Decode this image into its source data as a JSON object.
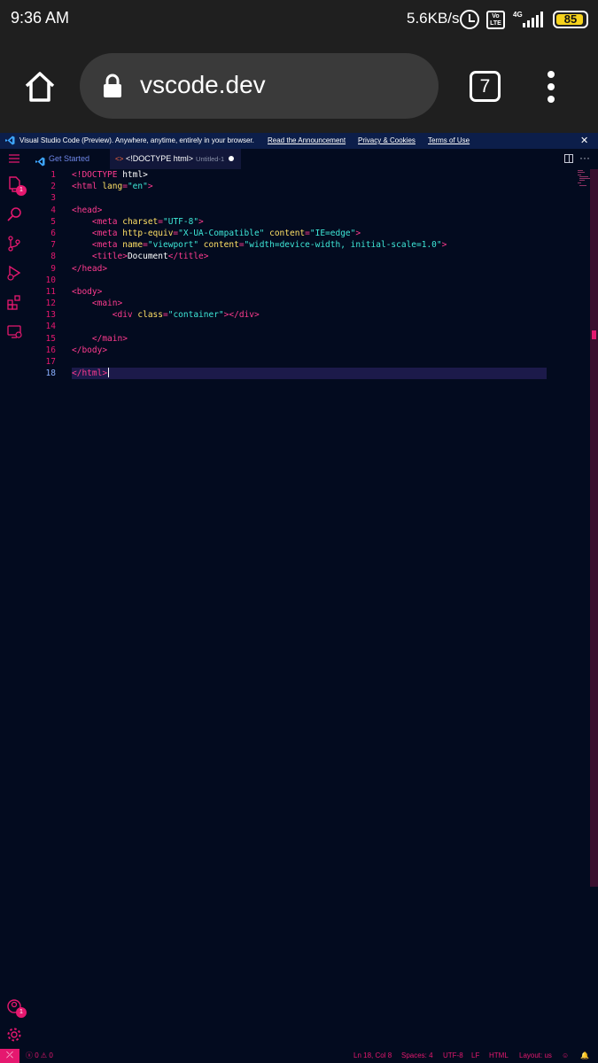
{
  "android_status": {
    "time": "9:36 AM",
    "net_speed": "5.6KB/s",
    "volte_label": "Vo\nLTE",
    "network": "4G",
    "battery": "85",
    "battery_color": "#f5d21b",
    "icons": [
      "alarm-icon",
      "volte-icon",
      "signal-icon",
      "battery-icon"
    ]
  },
  "browser": {
    "url": "vscode.dev",
    "tab_count": "7",
    "icons": [
      "home-icon",
      "lock-icon",
      "tabs-icon",
      "more-vert-icon"
    ]
  },
  "banner": {
    "message": "Visual Studio Code (Preview). Anywhere, anytime, entirely in your browser.",
    "links": [
      "Read the Announcement",
      "Privacy & Cookies",
      "Terms of Use"
    ],
    "close": "✕"
  },
  "activity_bar": {
    "items": [
      {
        "name": "explorer",
        "badge": "1"
      },
      {
        "name": "search"
      },
      {
        "name": "source-control"
      },
      {
        "name": "run-debug"
      },
      {
        "name": "extensions"
      },
      {
        "name": "remote-explorer"
      }
    ],
    "bottom": [
      {
        "name": "accounts",
        "badge": "1"
      },
      {
        "name": "manage"
      }
    ]
  },
  "tabs": [
    {
      "label": "Get Started",
      "icon": "vscode-icon"
    },
    {
      "label": "<!DOCTYPE html>",
      "description": "Untitled-1",
      "icon": "html-icon",
      "dirty": true
    }
  ],
  "editor": {
    "active_line": 18,
    "line_numbers": [
      "1",
      "2",
      "3",
      "4",
      "5",
      "6",
      "7",
      "8",
      "9",
      "10",
      "11",
      "12",
      "13",
      "14",
      "15",
      "16",
      "17",
      "18"
    ],
    "lines": [
      "<!DOCTYPE html>",
      "<html lang=\"en\">",
      "",
      "<head>",
      "    <meta charset=\"UTF-8\">",
      "    <meta http-equiv=\"X-UA-Compatible\" content=\"IE=edge\">",
      "    <meta name=\"viewport\" content=\"width=device-width, initial-scale=1.0\">",
      "    <title>Document</title>",
      "</head>",
      "",
      "<body>",
      "    <main>",
      "        <div class=\"container\"></div>",
      "",
      "    </main>",
      "</body>",
      "",
      "</html>"
    ]
  },
  "status_bar": {
    "remote": "⤫",
    "errors": "0",
    "warnings": "0",
    "position": "Ln 18, Col 8",
    "spaces": "Spaces: 4",
    "encoding": "UTF-8",
    "eol": "LF",
    "language": "HTML",
    "layout": "Layout: us",
    "accent_color": "#e5186f"
  }
}
